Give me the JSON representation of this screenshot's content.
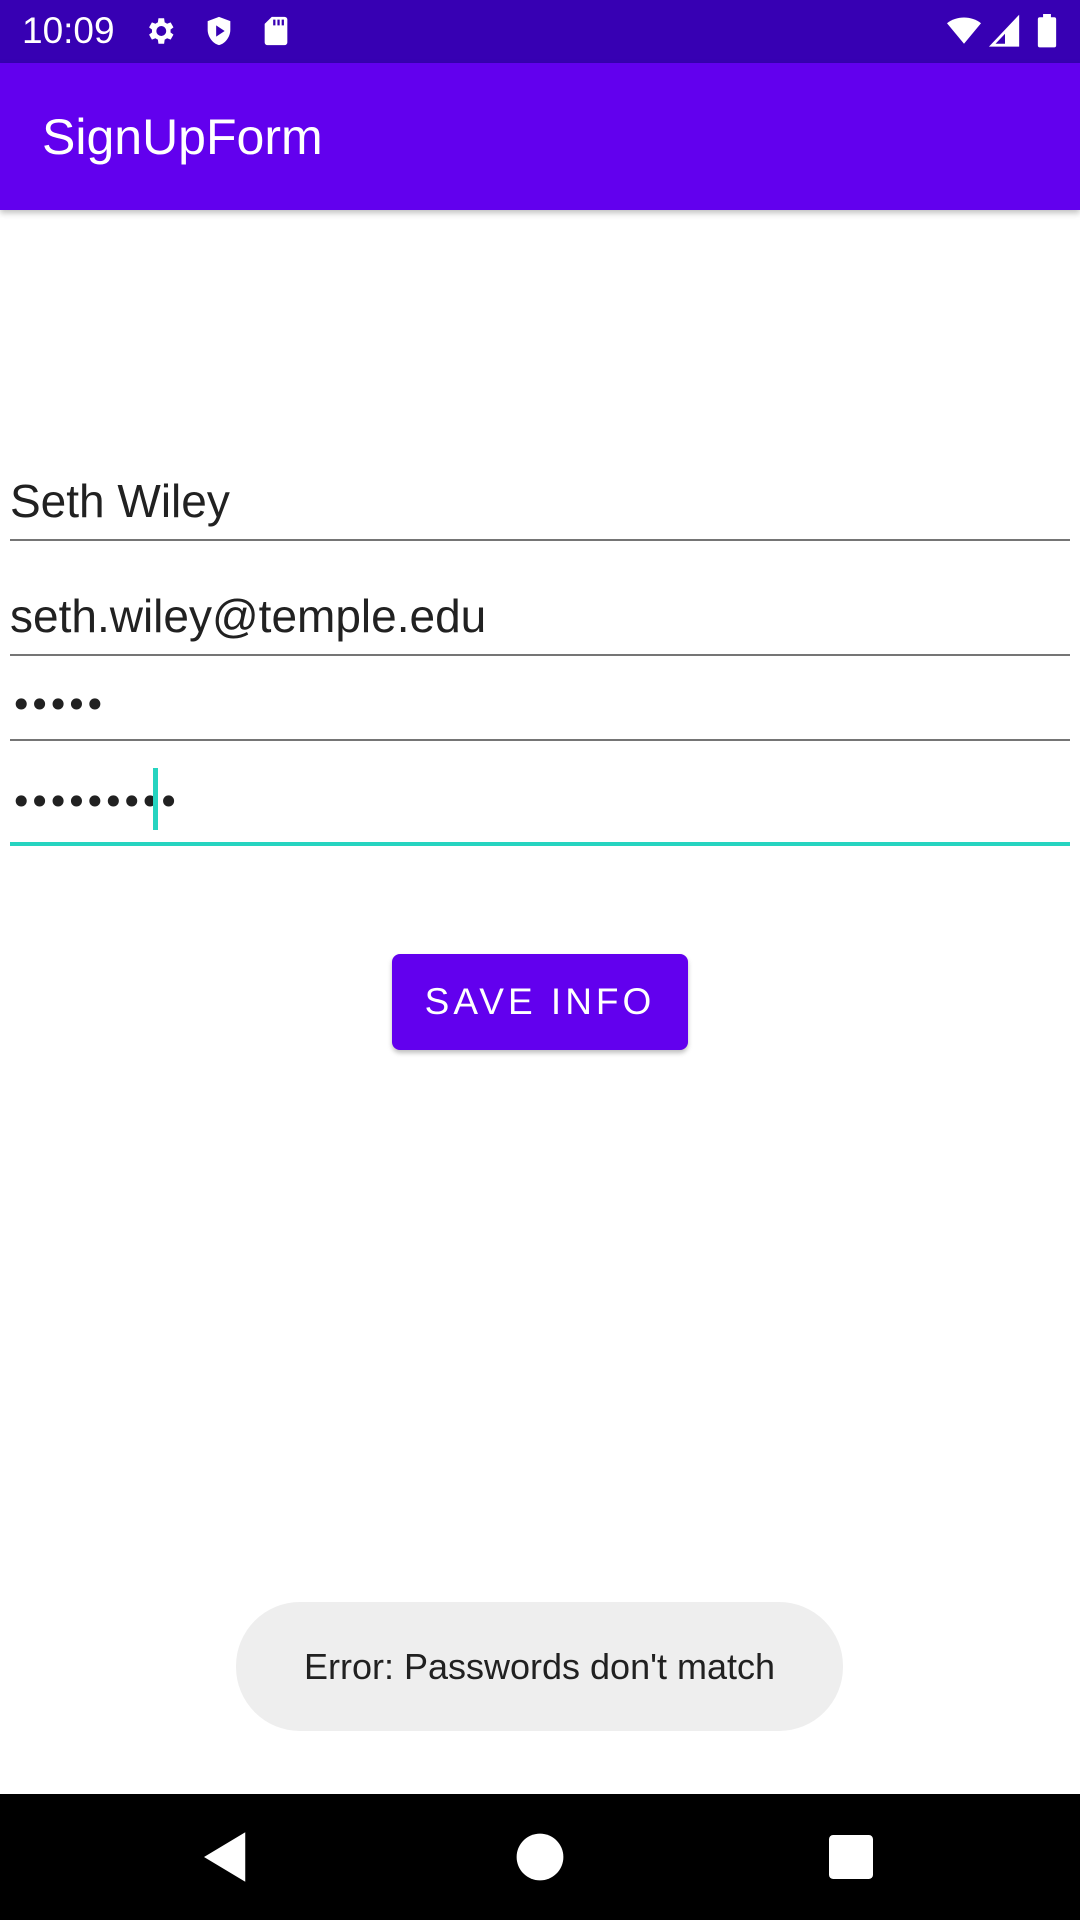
{
  "status_bar": {
    "time": "10:09",
    "icons": [
      "gear-icon",
      "shield-play-icon",
      "sd-card-icon",
      "wifi-icon",
      "cell-signal-icon",
      "battery-icon"
    ],
    "background": "#3700b3"
  },
  "app_bar": {
    "title": "SignUpForm",
    "background": "#6200ee"
  },
  "form": {
    "name_value": "Seth Wiley",
    "email_value": "seth.wiley@temple.edu",
    "password_masked": "•••••",
    "confirm_password_masked": "•••••••••",
    "focus_color": "#26d4c0"
  },
  "save_button": {
    "label": "SAVE INFO"
  },
  "toast": {
    "message": "Error: Passwords don't match"
  },
  "nav_bar": {
    "icons": [
      "back-icon",
      "home-icon",
      "recents-icon"
    ]
  }
}
